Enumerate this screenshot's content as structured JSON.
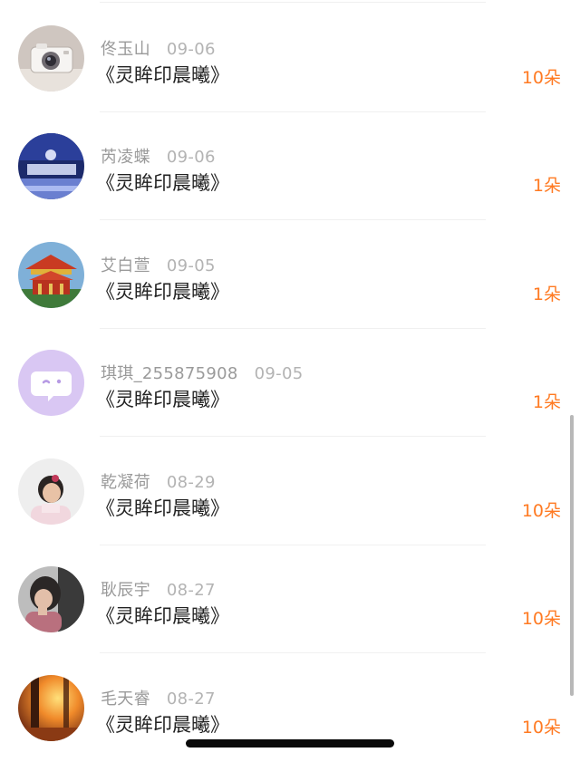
{
  "colors": {
    "accent": "#ff7a22",
    "name": "#9a9a9a",
    "title": "#222222"
  },
  "gifts": [
    {
      "name": "佟玉山",
      "date": "09-06",
      "title": "《灵眸印晨曦》",
      "count": "10朵",
      "avatar": "camera-photo"
    },
    {
      "name": "芮凌蝶",
      "date": "09-06",
      "title": "《灵眸印晨曦》",
      "count": "1朵",
      "avatar": "blue-glass-photo"
    },
    {
      "name": "艾白萱",
      "date": "09-05",
      "title": "《灵眸印晨曦》",
      "count": "1朵",
      "avatar": "pavilion-photo"
    },
    {
      "name": "琪琪_255875908",
      "date": "09-05",
      "title": "《灵眸印晨曦》",
      "count": "1朵",
      "avatar": "default-chat-avatar"
    },
    {
      "name": "乾凝荷",
      "date": "08-29",
      "title": "《灵眸印晨曦》",
      "count": "10朵",
      "avatar": "child-photo"
    },
    {
      "name": "耿辰宇",
      "date": "08-27",
      "title": "《灵眸印晨曦》",
      "count": "10朵",
      "avatar": "portrait-photo"
    },
    {
      "name": "毛天睿",
      "date": "08-27",
      "title": "《灵眸印晨曦》",
      "count": "10朵",
      "avatar": "sunset-forest-photo"
    }
  ]
}
